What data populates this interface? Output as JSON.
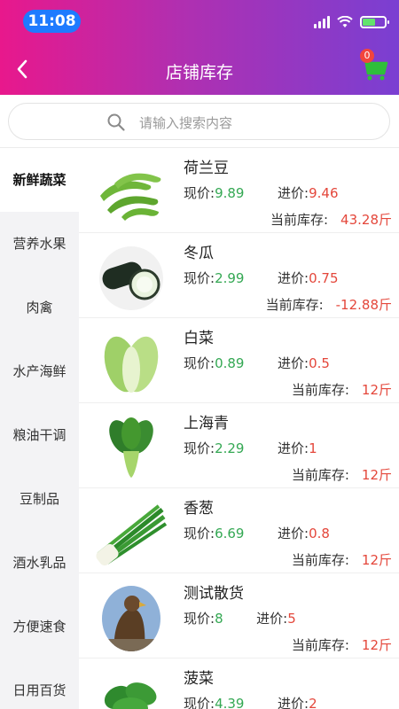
{
  "status": {
    "time": "11:08"
  },
  "nav": {
    "title": "店铺库存",
    "cart_count": "0"
  },
  "search": {
    "placeholder": "请输入搜索内容"
  },
  "categories": [
    {
      "label": "新鲜蔬菜",
      "active": true
    },
    {
      "label": "营养水果"
    },
    {
      "label": "肉禽"
    },
    {
      "label": "水产海鲜"
    },
    {
      "label": "粮油干调"
    },
    {
      "label": "豆制品"
    },
    {
      "label": "酒水乳品"
    },
    {
      "label": "方便速食"
    },
    {
      "label": "日用百货"
    }
  ],
  "labels": {
    "now_price": "现价:",
    "in_price": "进价:",
    "stock": "当前库存:"
  },
  "products": [
    {
      "name": "荷兰豆",
      "now": "9.89",
      "in": "9.46",
      "stock": "43.28斤",
      "image": "snow-pea-image"
    },
    {
      "name": "冬瓜",
      "now": "2.99",
      "in": "0.75",
      "stock": "-12.88斤",
      "image": "winter-melon-image"
    },
    {
      "name": "白菜",
      "now": "0.89",
      "in": "0.5",
      "stock": "12斤",
      "image": "cabbage-image"
    },
    {
      "name": "上海青",
      "now": "2.29",
      "in": "1",
      "stock": "12斤",
      "image": "bok-choy-image"
    },
    {
      "name": "香葱",
      "now": "6.69",
      "in": "0.8",
      "stock": "12斤",
      "image": "scallion-image"
    },
    {
      "name": "测试散货",
      "now": "8",
      "in": "5",
      "stock": "12斤",
      "image": "eagle-image"
    },
    {
      "name": "菠菜",
      "now": "4.39",
      "in": "2",
      "stock": "",
      "image": "spinach-image"
    }
  ],
  "colors": {
    "header_start": "#e8188c",
    "header_end": "#7a3fd2",
    "now_price": "#34a853",
    "in_price": "#e4473b",
    "cart": "#2fbf3a"
  }
}
